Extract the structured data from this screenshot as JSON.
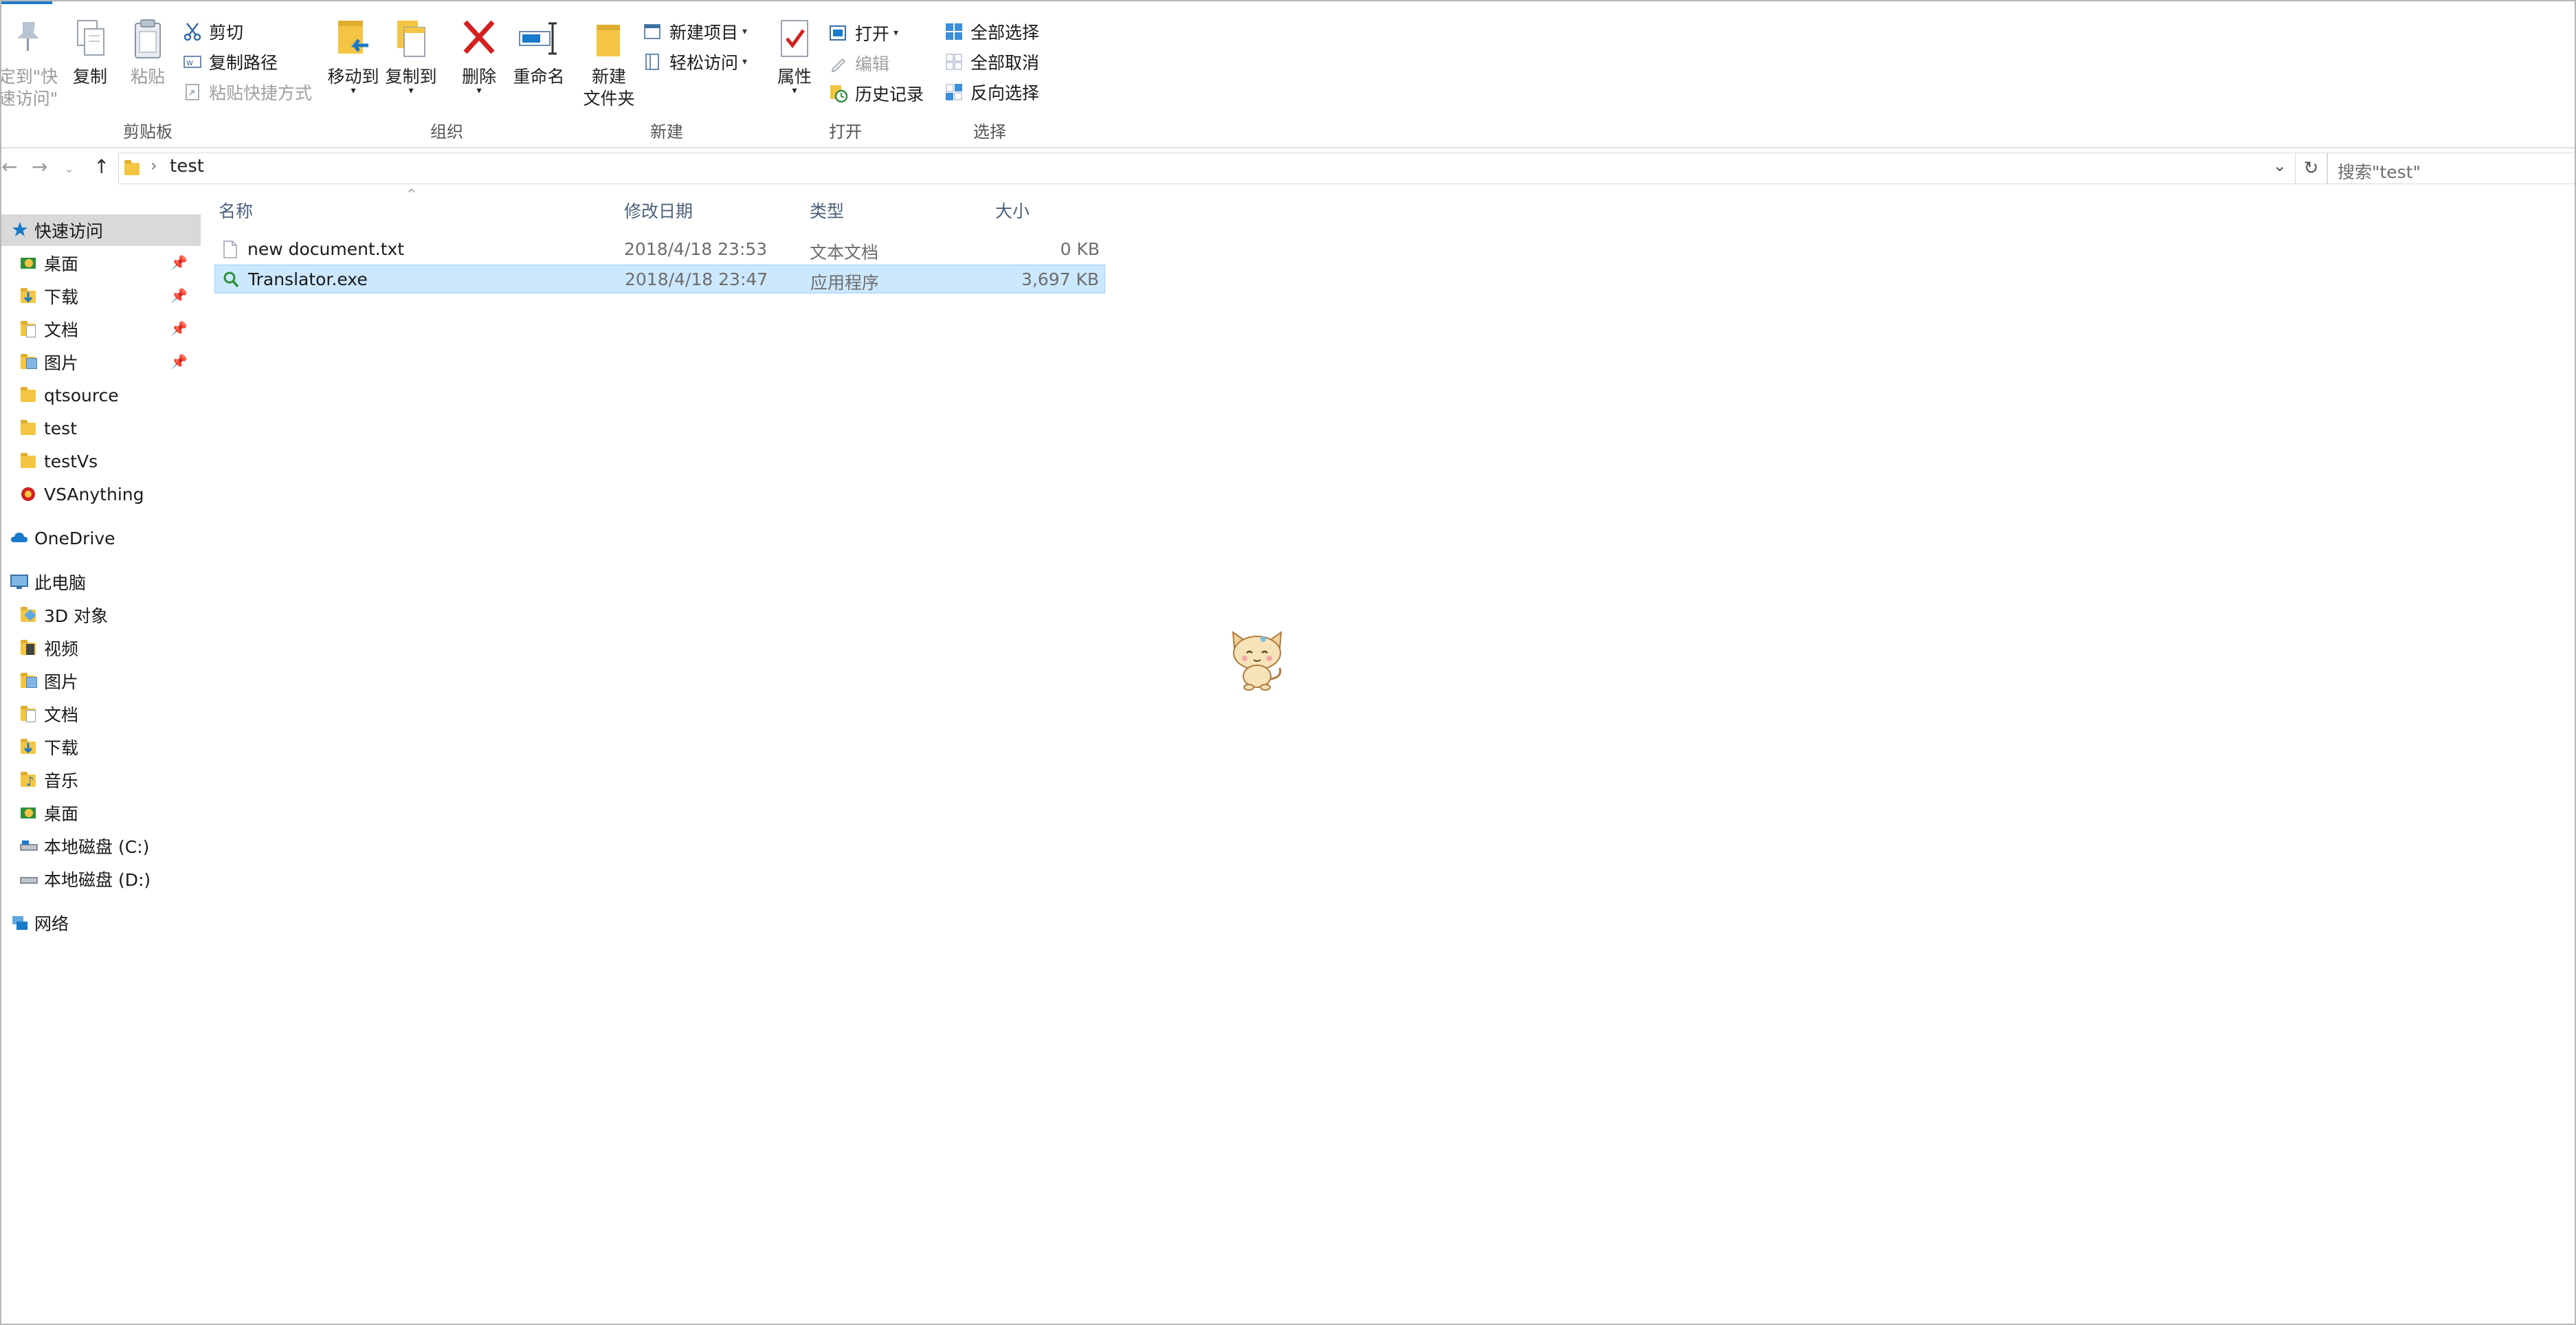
{
  "ribbon": {
    "pin_label": "定到\"快\n速访问\"",
    "copy_label": "复制",
    "paste_label": "粘贴",
    "cut_label": "剪切",
    "copy_path_label": "复制路径",
    "paste_shortcut_label": "粘贴快捷方式",
    "move_to_label": "移动到",
    "copy_to_label": "复制到",
    "delete_label": "删除",
    "rename_label": "重命名",
    "new_folder_label": "新建\n文件夹",
    "new_item_label": "新建项目",
    "easy_access_label": "轻松访问",
    "properties_label": "属性",
    "open_label": "打开",
    "edit_label": "编辑",
    "history_label": "历史记录",
    "select_all_label": "全部选择",
    "select_none_label": "全部取消",
    "invert_selection_label": "反向选择",
    "groups": {
      "clipboard": "剪贴板",
      "organize": "组织",
      "new": "新建",
      "open": "打开",
      "select": "选择"
    }
  },
  "address": {
    "breadcrumb": "test",
    "search_placeholder": "搜索\"test\""
  },
  "nav": {
    "quick_access": "快速访问",
    "qa_items": [
      "桌面",
      "下载",
      "文档",
      "图片",
      "qtsource",
      "test",
      "testVs",
      "VSAnything"
    ],
    "onedrive": "OneDrive",
    "this_pc": "此电脑",
    "pc_items": [
      "3D 对象",
      "视频",
      "图片",
      "文档",
      "下载",
      "音乐",
      "桌面",
      "本地磁盘 (C:)",
      "本地磁盘 (D:)"
    ],
    "network": "网络"
  },
  "columns": {
    "name": "名称",
    "modified": "修改日期",
    "type": "类型",
    "size": "大小"
  },
  "files": [
    {
      "name": "new document.txt",
      "modified": "2018/4/18 23:53",
      "type": "文本文档",
      "size": "0 KB"
    },
    {
      "name": "Translator.exe",
      "modified": "2018/4/18 23:47",
      "type": "应用程序",
      "size": "3,697 KB"
    }
  ],
  "colors": {
    "accent": "#1979ca",
    "selection": "#cce8ff",
    "nav_selected": "#d9d9d9",
    "delete_red": "#d42020"
  }
}
